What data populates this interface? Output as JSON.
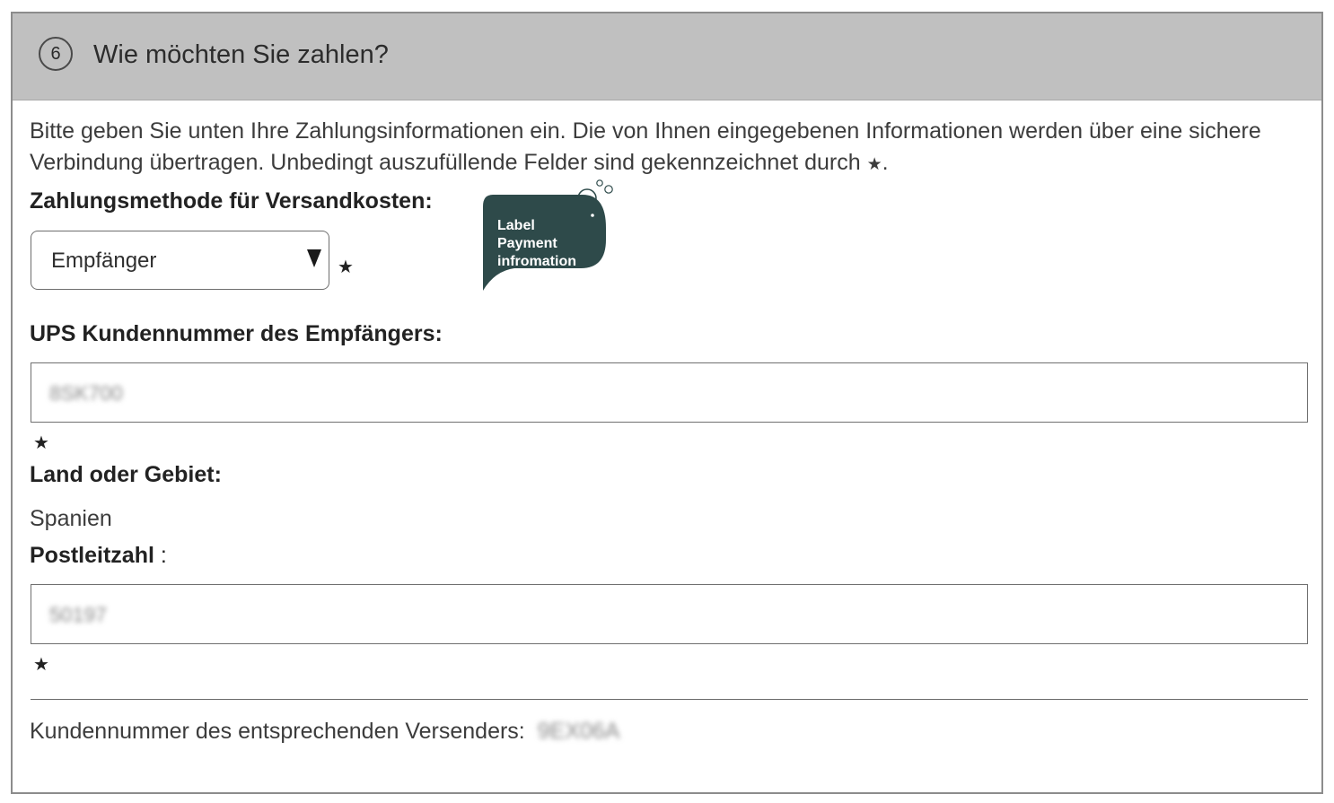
{
  "header": {
    "step_number": "6",
    "title": "Wie möchten Sie zahlen?"
  },
  "intro": {
    "text": "Bitte geben Sie unten Ihre Zahlungsinformationen ein. Die von Ihnen eingegebenen Informationen werden über eine sichere Verbindung übertragen. Unbedingt auszufüllende Felder sind gekennzeichnet durch",
    "required_marker": "★",
    "end": "."
  },
  "payment_method": {
    "label": "Zahlungsmethode für Versandkosten:",
    "selected_value": "Empfänger",
    "required_marker": "★"
  },
  "ups_account": {
    "label": "UPS Kundennummer des Empfängers:",
    "value": "8SK700",
    "required_marker": "★"
  },
  "country": {
    "label": "Land oder Gebiet:",
    "value": "Spanien"
  },
  "postal_code": {
    "label": "Postleitzahl",
    "label_suffix": " :",
    "value": "50197",
    "required_marker": "★"
  },
  "shipper": {
    "label": "Kundennummer des entsprechenden Versenders:",
    "value": "9EX06A"
  },
  "annotation": {
    "text": "Label\nPayment\ninfromation",
    "bubble_color": "#2e4a4a"
  }
}
